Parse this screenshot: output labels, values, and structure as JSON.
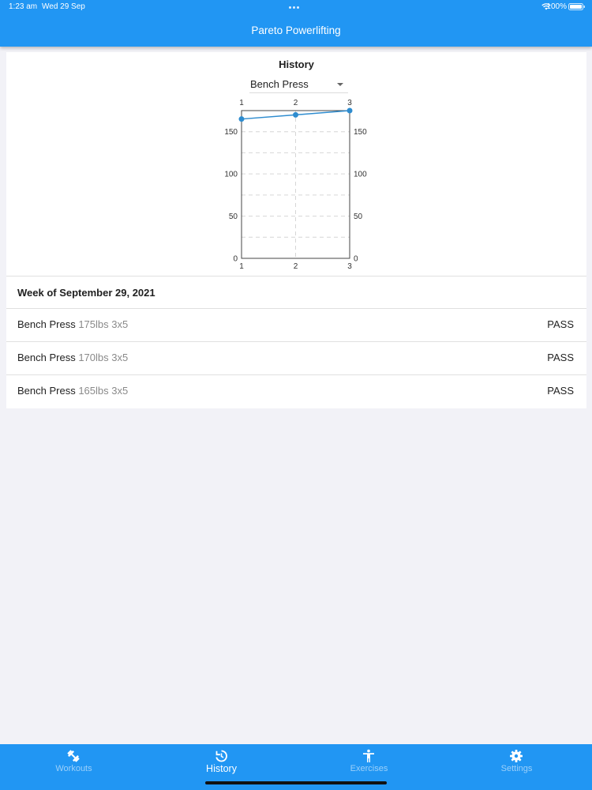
{
  "status_bar": {
    "time": "1:23 am",
    "date": "Wed 29 Sep",
    "battery": "100%"
  },
  "app": {
    "title": "Pareto Powerlifting"
  },
  "history": {
    "title": "History",
    "selected_exercise": "Bench Press"
  },
  "chart_data": {
    "type": "line",
    "x": [
      1,
      2,
      3
    ],
    "series": [
      {
        "values": [
          165,
          170,
          175
        ]
      }
    ],
    "x_ticks": [
      "1",
      "2",
      "3"
    ],
    "y_ticks": [
      "0",
      "50",
      "100",
      "150"
    ],
    "xlim": [
      1,
      3
    ],
    "ylim": [
      0,
      175
    ],
    "grid": true,
    "color": "#2e8ccf"
  },
  "week": {
    "heading": "Week of September 29, 2021",
    "rows": [
      {
        "name": "Bench Press",
        "detail": "175lbs 3x5",
        "result": "PASS"
      },
      {
        "name": "Bench Press",
        "detail": "170lbs 3x5",
        "result": "PASS"
      },
      {
        "name": "Bench Press",
        "detail": "165lbs 3x5",
        "result": "PASS"
      }
    ]
  },
  "nav": {
    "items": [
      {
        "label": "Workouts",
        "icon": "dumbbell-icon",
        "active": false
      },
      {
        "label": "History",
        "icon": "history-icon",
        "active": true
      },
      {
        "label": "Exercises",
        "icon": "person-icon",
        "active": false
      },
      {
        "label": "Settings",
        "icon": "gear-icon",
        "active": false
      }
    ]
  },
  "colors": {
    "primary": "#2196f3",
    "background": "#f2f2f7",
    "line": "#2e8ccf"
  }
}
